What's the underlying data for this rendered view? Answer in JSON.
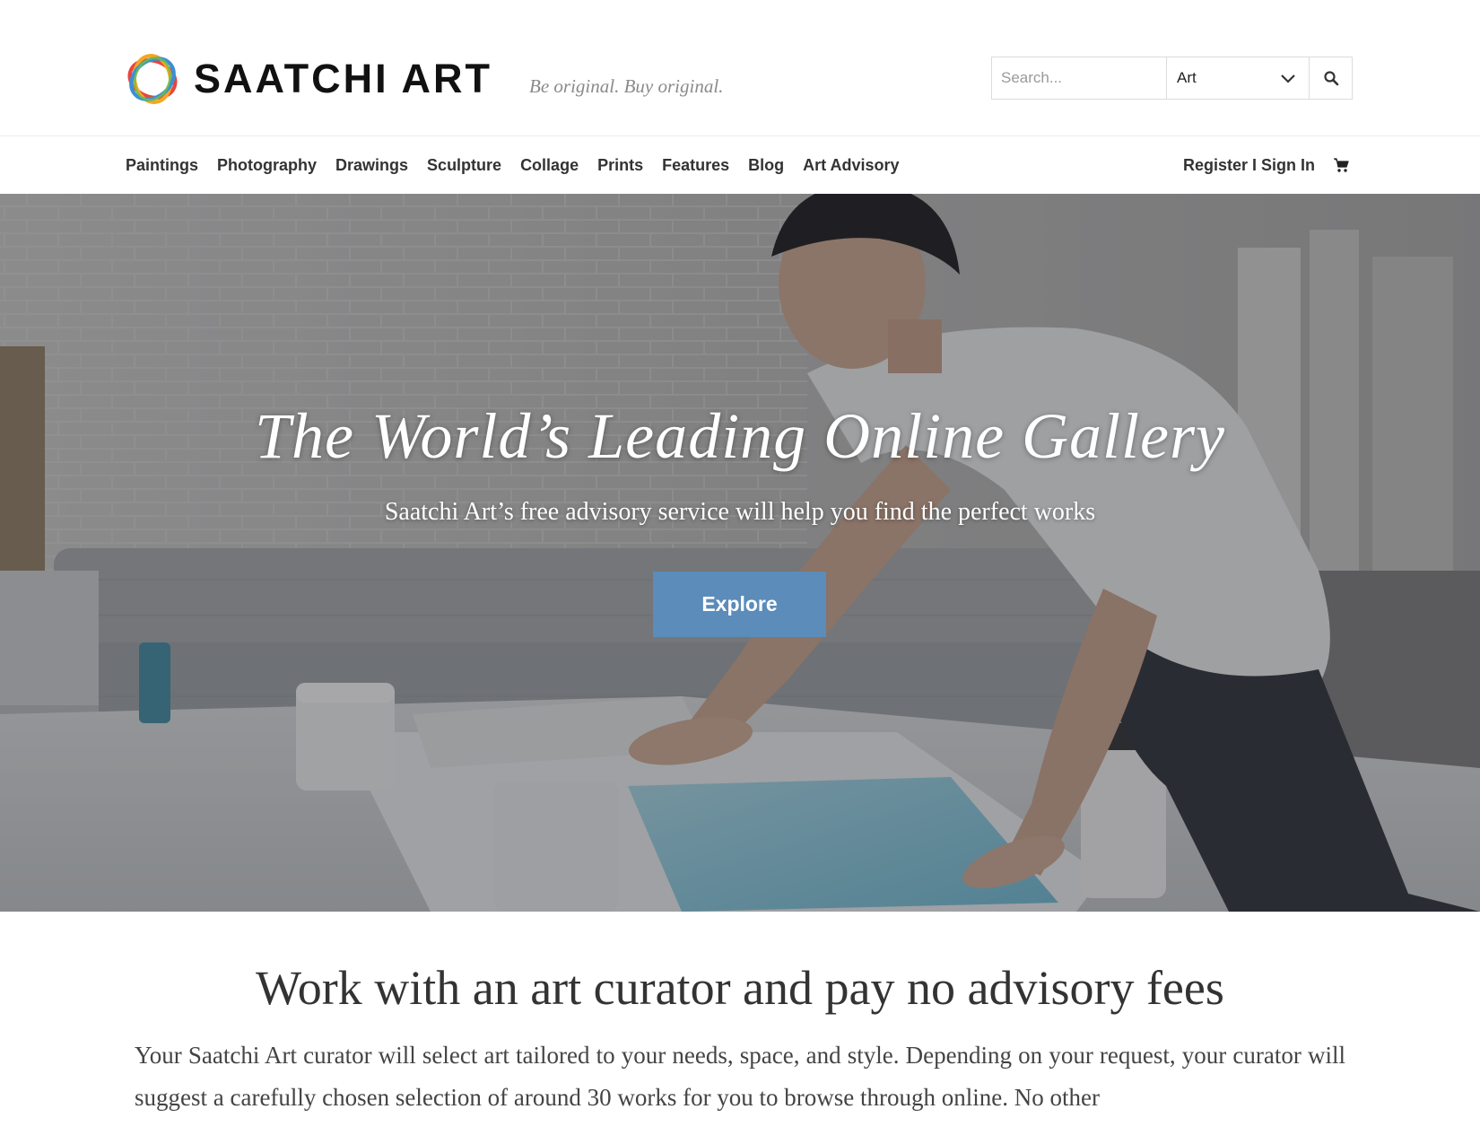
{
  "brand": {
    "name": "SAATCHI ART",
    "tagline": "Be original. Buy original.",
    "logo_icon": "interlocking-rings-logo-icon"
  },
  "search": {
    "placeholder": "Search...",
    "value": "",
    "category_selected": "Art",
    "category_icon": "chevron-down-icon",
    "button_icon": "search-icon"
  },
  "nav": {
    "items": [
      {
        "label": "Paintings"
      },
      {
        "label": "Photography"
      },
      {
        "label": "Drawings"
      },
      {
        "label": "Sculpture"
      },
      {
        "label": "Collage"
      },
      {
        "label": "Prints"
      },
      {
        "label": "Features"
      },
      {
        "label": "Blog"
      },
      {
        "label": "Art Advisory"
      }
    ],
    "account_label": "Register I Sign In",
    "cart_icon": "shopping-cart-icon"
  },
  "hero": {
    "title": "The World’s Leading Online Gallery",
    "subtitle": "Saatchi Art’s free advisory service will help you find the perfect works",
    "cta_label": "Explore",
    "cta_color": "#5b8cba"
  },
  "advisory": {
    "heading": "Work with an art curator and pay no advisory fees",
    "body": "Your Saatchi Art curator will select art tailored to your needs, space, and style. Depending on your request, your curator will suggest a carefully chosen selection of around 30 works for you to browse through online. No other"
  }
}
